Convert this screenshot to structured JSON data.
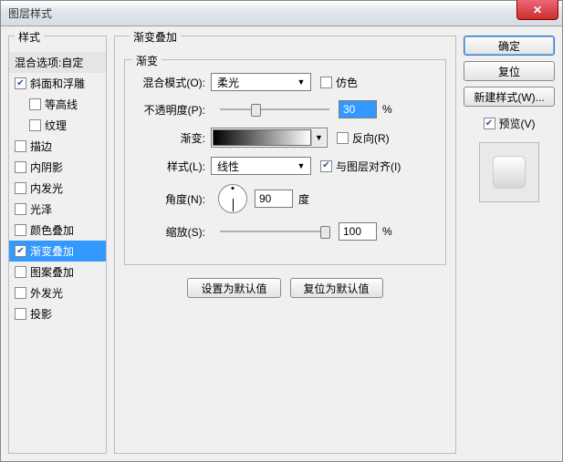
{
  "window": {
    "title": "图层样式"
  },
  "styles_panel": {
    "title": "样式",
    "header": "混合选项:自定",
    "items": [
      {
        "label": "斜面和浮雕",
        "checked": true,
        "sub": false
      },
      {
        "label": "等高线",
        "checked": false,
        "sub": true
      },
      {
        "label": "纹理",
        "checked": false,
        "sub": true
      },
      {
        "label": "描边",
        "checked": false,
        "sub": false
      },
      {
        "label": "内阴影",
        "checked": false,
        "sub": false
      },
      {
        "label": "内发光",
        "checked": false,
        "sub": false
      },
      {
        "label": "光泽",
        "checked": false,
        "sub": false
      },
      {
        "label": "颜色叠加",
        "checked": false,
        "sub": false
      },
      {
        "label": "渐变叠加",
        "checked": true,
        "sub": false,
        "selected": true
      },
      {
        "label": "图案叠加",
        "checked": false,
        "sub": false
      },
      {
        "label": "外发光",
        "checked": false,
        "sub": false
      },
      {
        "label": "投影",
        "checked": false,
        "sub": false
      }
    ]
  },
  "main": {
    "title": "渐变叠加",
    "inner_title": "渐变",
    "blend_label": "混合模式(O):",
    "blend_value": "柔光",
    "dither": {
      "label": "仿色",
      "checked": false
    },
    "opacity_label": "不透明度(P):",
    "opacity_value": "30",
    "opacity_unit": "%",
    "gradient_label": "渐变:",
    "reverse": {
      "label": "反向(R)",
      "checked": false
    },
    "style_label": "样式(L):",
    "style_value": "线性",
    "align": {
      "label": "与图层对齐(I)",
      "checked": true
    },
    "angle_label": "角度(N):",
    "angle_value": "90",
    "angle_unit": "度",
    "scale_label": "缩放(S):",
    "scale_value": "100",
    "scale_unit": "%",
    "reset_default": "设置为默认值",
    "restore_default": "复位为默认值"
  },
  "side": {
    "ok": "确定",
    "cancel": "复位",
    "new_style": "新建样式(W)...",
    "preview_label": "预览(V)",
    "preview_checked": true
  }
}
